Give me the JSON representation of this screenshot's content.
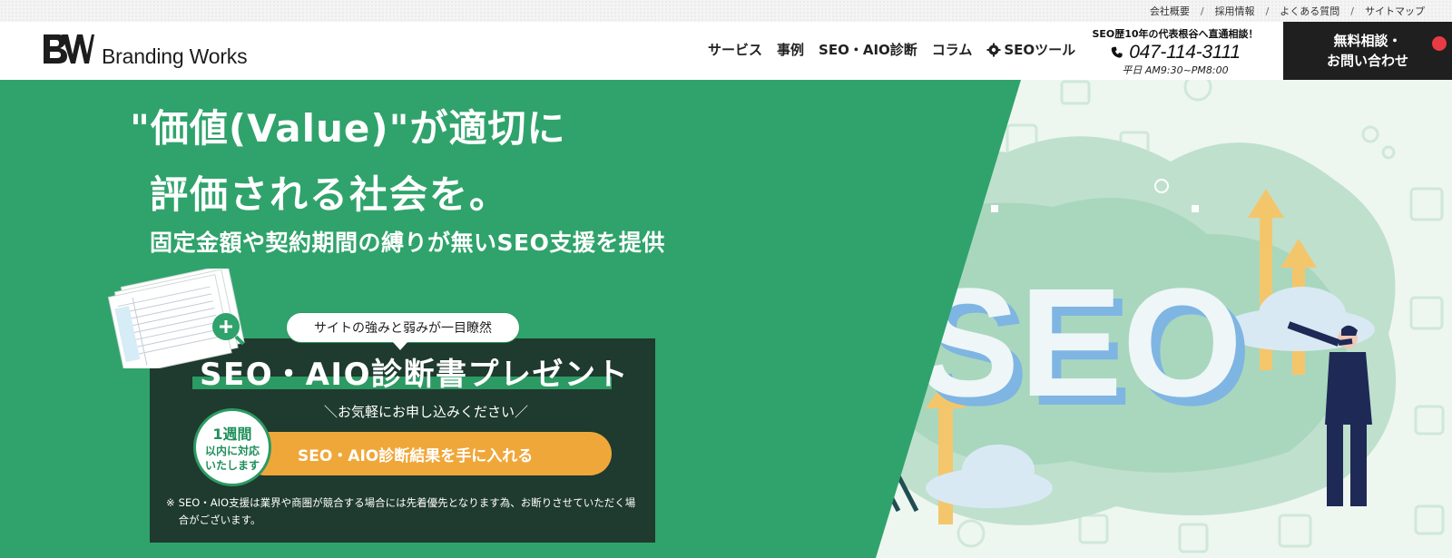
{
  "utility_links": [
    "会社概要",
    "採用情報",
    "よくある質問",
    "サイトマップ"
  ],
  "utility_separator": "/",
  "header": {
    "logo_text": "Branding Works",
    "nav": [
      "サービス",
      "事例",
      "SEO・AIO診断",
      "コラム",
      "SEOツール"
    ],
    "phone_note": "SEO歴10年の代表根谷へ直通相談！",
    "phone_number": "047-114-3111",
    "phone_hours": "平日 AM9:30~PM8:00",
    "cta_line1": "無料相談・",
    "cta_line2": "お問い合わせ"
  },
  "hero": {
    "headline_line1": "\"価値(Value)\"が適切に",
    "headline_line2": "評価される社会を。",
    "subheadline": "固定金額や契約期間の縛りが無いSEO支援を提供",
    "illustration_text": "SEO"
  },
  "promo": {
    "bubble": "サイトの強みと弱みが一目瞭然",
    "title": "SEO・AIO診断書プレゼント",
    "note": "＼お気軽にお申し込みください／",
    "badge_line1": "1週間",
    "badge_line2": "以内に対応",
    "badge_line3": "いたします",
    "button": "SEO・AIO診断結果を手に入れる",
    "disclaimer_mark": "※",
    "disclaimer": "SEO・AIO支援は業界や商圏が競合する場合には先着優先となります為、お断りさせていただく場合がございます。"
  },
  "colors": {
    "green": "#2fa36b",
    "dark_green": "#1f3a2e",
    "orange": "#f0a73a",
    "cta_black": "#1f1f1f",
    "notification_red": "#e83b45"
  },
  "icons": [
    "phone-icon",
    "gear-icon",
    "magnify-plus-icon"
  ]
}
